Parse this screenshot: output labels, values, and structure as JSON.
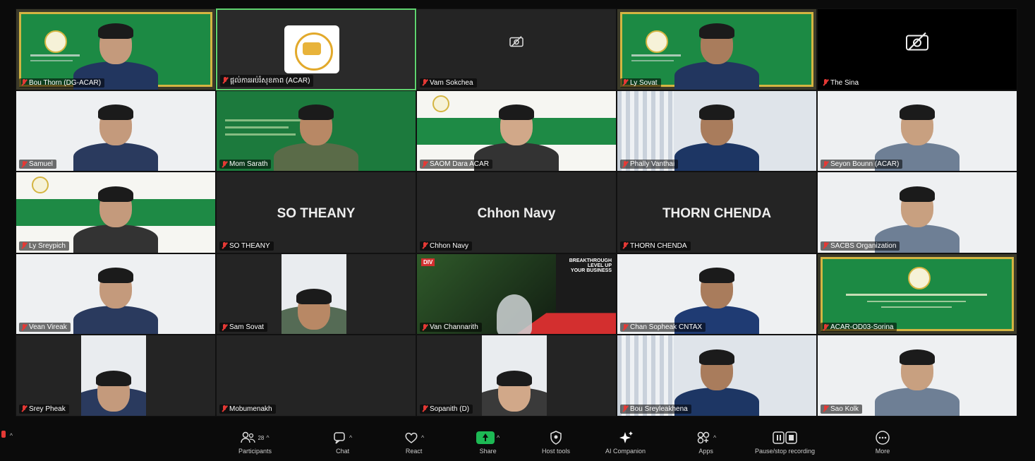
{
  "participants": [
    {
      "name": "Bou Thorn (DG-ACAR)",
      "kind": "banner-person"
    },
    {
      "name": "ផ្ដល់ការអប់រំសុខភាព (ACAR)",
      "kind": "logo-screen"
    },
    {
      "name": "Vam Sokchea",
      "kind": "camera-off"
    },
    {
      "name": "Ly Sovat",
      "kind": "banner-person"
    },
    {
      "name": "The Sina",
      "kind": "camera-off-large"
    },
    {
      "name": "Samuel",
      "kind": "person-white"
    },
    {
      "name": "Mom Sarath",
      "kind": "green-slide-person"
    },
    {
      "name": "SAOM Dara ACAR",
      "kind": "slide-person"
    },
    {
      "name": "Phally Vanthai",
      "kind": "office-person"
    },
    {
      "name": "Seyon Bounn (ACAR)",
      "kind": "person-white"
    },
    {
      "name": "Ly Sreypich",
      "kind": "slide-person"
    },
    {
      "name": "SO THEANY",
      "kind": "name-only"
    },
    {
      "name": "Chhon Navy",
      "kind": "name-only"
    },
    {
      "name": "THORN CHENDA",
      "kind": "name-only"
    },
    {
      "name": "SACBS Organization",
      "kind": "person-white"
    },
    {
      "name": "Vean Vireak",
      "kind": "person-white"
    },
    {
      "name": "Sam Sovat",
      "kind": "small-video"
    },
    {
      "name": "Van Channarith",
      "kind": "ad-screen"
    },
    {
      "name": "Chan Sopheak CNTAX",
      "kind": "person-white"
    },
    {
      "name": "ACAR-OD03-Sorina",
      "kind": "banner-logo"
    },
    {
      "name": "Srey Pheak",
      "kind": "small-video"
    },
    {
      "name": "Mobumenakh",
      "kind": "empty"
    },
    {
      "name": "Sopanith (D)",
      "kind": "small-video"
    },
    {
      "name": "Bou Sreyleakhena",
      "kind": "office-person"
    },
    {
      "name": "Sao Kolk",
      "kind": "person-white"
    }
  ],
  "ad_screen": {
    "headline": "BREAKTHROUGH",
    "sub": "LEVEL UP",
    "sub2": "YOUR BUSINESS",
    "brand": "DIV"
  },
  "toolbar": {
    "participants_count": "28",
    "items": [
      {
        "label": "Participants",
        "icon": "participants-icon"
      },
      {
        "label": "Chat",
        "icon": "chat-icon"
      },
      {
        "label": "React",
        "icon": "react-icon"
      },
      {
        "label": "Share",
        "icon": "share-icon"
      },
      {
        "label": "Host tools",
        "icon": "shield-icon"
      },
      {
        "label": "AI Companion",
        "icon": "sparkle-icon"
      },
      {
        "label": "Apps",
        "icon": "apps-icon"
      },
      {
        "label": "Pause/stop recording",
        "icon": "recording-icon"
      },
      {
        "label": "More",
        "icon": "more-icon"
      }
    ]
  },
  "colors": {
    "active_border": "#5fd36f",
    "banner_green": "#1f8f47",
    "banner_gold": "#d4b542",
    "share_green": "#1db954",
    "muted_red": "#e53935"
  }
}
